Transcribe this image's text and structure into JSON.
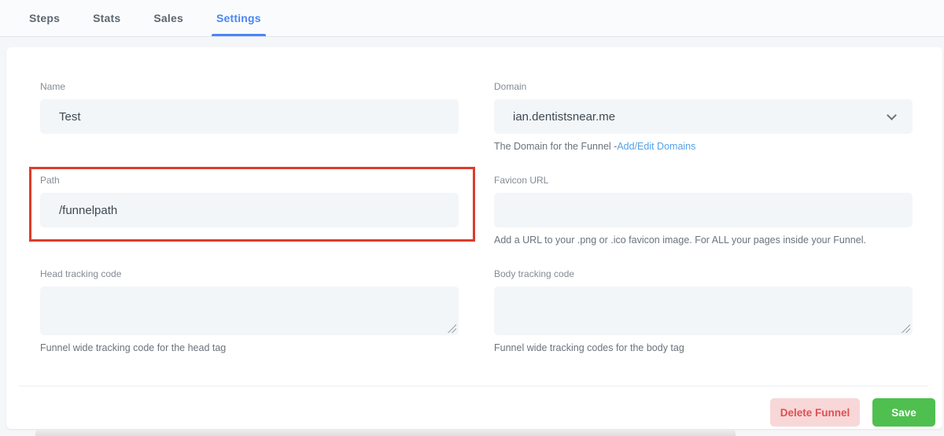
{
  "tabs": [
    {
      "label": "Steps",
      "active": false
    },
    {
      "label": "Stats",
      "active": false
    },
    {
      "label": "Sales",
      "active": false
    },
    {
      "label": "Settings",
      "active": true
    }
  ],
  "form": {
    "name": {
      "label": "Name",
      "value": "Test"
    },
    "domain": {
      "label": "Domain",
      "value": "ian.dentistsnear.me",
      "helper_prefix": "The Domain for the Funnel -",
      "helper_link": "Add/Edit Domains"
    },
    "path": {
      "label": "Path",
      "value": "/funnelpath"
    },
    "favicon": {
      "label": "Favicon URL",
      "value": "",
      "helper": "Add a URL to your .png or .ico favicon image. For ALL your pages inside your Funnel."
    },
    "head_tracking": {
      "label": "Head tracking code",
      "value": "",
      "helper": "Funnel wide tracking code for the head tag"
    },
    "body_tracking": {
      "label": "Body tracking code",
      "value": "",
      "helper": "Funnel wide tracking codes for the body tag"
    }
  },
  "footer": {
    "delete_label": "Delete Funnel",
    "save_label": "Save"
  },
  "annotation": {
    "type": "highlight-rectangle",
    "target": "path-field",
    "color": "#dc3c2c"
  },
  "colors": {
    "tab_active": "#4a86f7",
    "link": "#56a1e6",
    "input_bg": "#f3f6f8",
    "delete_bg": "#f8d7d8",
    "delete_text": "#e05050",
    "save_bg": "#4fbf50"
  }
}
